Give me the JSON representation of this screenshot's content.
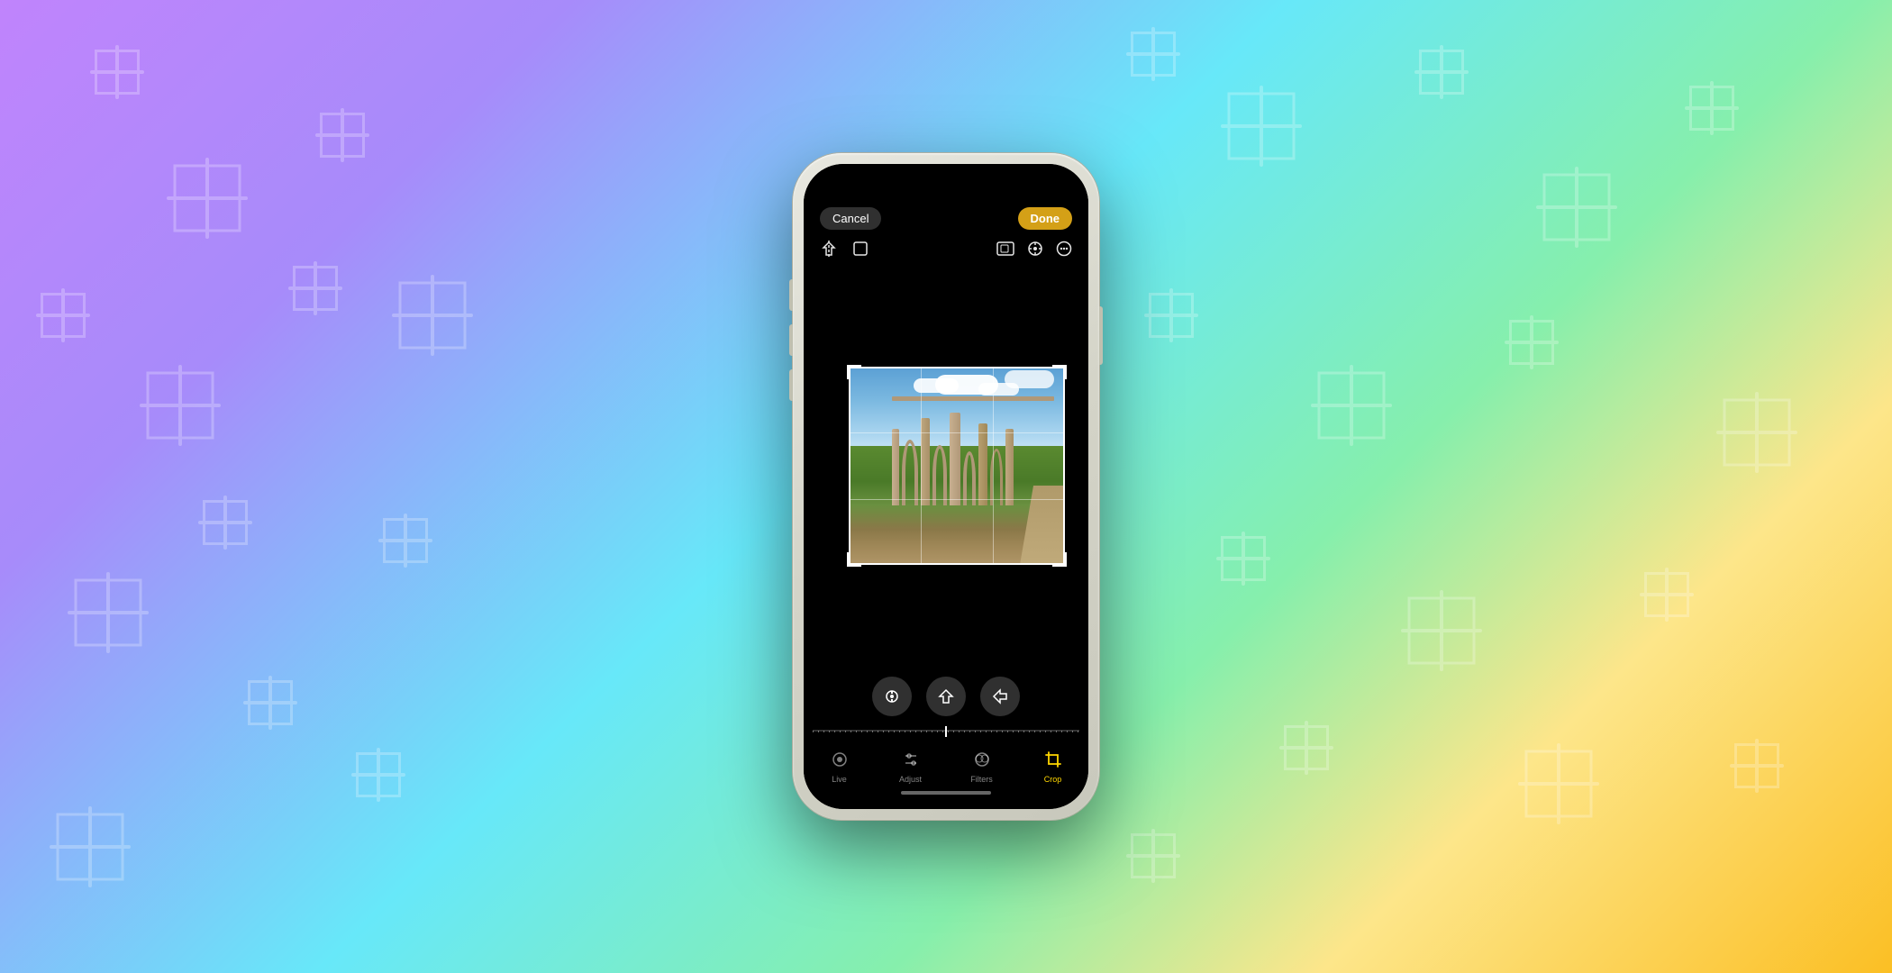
{
  "background": {
    "gradient_start": "#c084fc",
    "gradient_end": "#fbbf24"
  },
  "phone": {
    "top_bar": {
      "cancel_label": "Cancel",
      "done_label": "Done"
    },
    "tools": {
      "left": [
        "flip-icon",
        "crop-ratio-icon"
      ],
      "right": [
        "aspect-icon",
        "compass-icon",
        "more-icon"
      ]
    },
    "photo": {
      "description": "Ancient Roman aqueduct ruins on green field with blue sky"
    },
    "rotation_buttons": [
      {
        "id": "straighten",
        "label": "⊖"
      },
      {
        "id": "flip-v",
        "label": "△"
      },
      {
        "id": "flip-h",
        "label": "◁"
      }
    ],
    "tab_bar": {
      "tabs": [
        {
          "id": "live",
          "label": "Live",
          "active": false
        },
        {
          "id": "adjust",
          "label": "Adjust",
          "active": false
        },
        {
          "id": "filters",
          "label": "Filters",
          "active": false
        },
        {
          "id": "crop",
          "label": "Crop",
          "active": true
        }
      ]
    },
    "home_indicator": true
  }
}
